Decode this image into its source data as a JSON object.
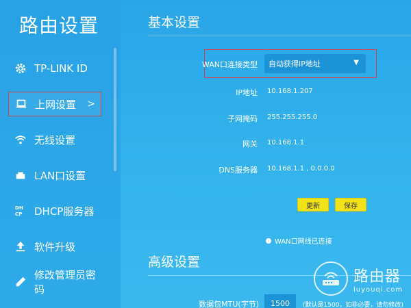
{
  "sidebar": {
    "title": "路由设置",
    "items": [
      {
        "label": "TP-LINK ID",
        "icon": "gear-icon",
        "active": false
      },
      {
        "label": "上网设置",
        "icon": "laptop-icon",
        "active": true,
        "chevron": ">"
      },
      {
        "label": "无线设置",
        "icon": "wifi-icon",
        "active": false
      },
      {
        "label": "LAN口设置",
        "icon": "lan-port-icon",
        "active": false
      },
      {
        "label": "DHCP服务器",
        "icon": "dhcp-icon",
        "active": false
      },
      {
        "label": "软件升级",
        "icon": "upload-icon",
        "active": false
      },
      {
        "label": "修改管理员密码",
        "icon": "pencil-icon",
        "active": false
      }
    ]
  },
  "basic": {
    "title": "基本设置",
    "wan_label": "WAN口连接类型",
    "wan_value": "自动获得IP地址",
    "ip_label": "IP地址",
    "ip_value": "10.168.1.207",
    "mask_label": "子网掩码",
    "mask_value": "255.255.255.0",
    "gateway_label": "网关",
    "gateway_value": "10.168.1.1",
    "dns_label": "DNS服务器",
    "dns_value": "10.168.1.1 , 0.0.0.0",
    "refresh_label": "更新",
    "save_label": "保存",
    "status_text": "WAN口网线已连接"
  },
  "advanced": {
    "title": "高级设置",
    "mtu_label": "数据包MTU(字节)",
    "mtu_value": "1500",
    "mtu_note": "(默认是1500，如非必要，请勿修改)"
  },
  "watermark": {
    "text": "路由器",
    "url": "luyouqi.com"
  },
  "colors": {
    "background": "#2ea8e6",
    "button": "#f2e21a",
    "highlight_border": "#d94343",
    "select_bg": "#1c93d6"
  }
}
